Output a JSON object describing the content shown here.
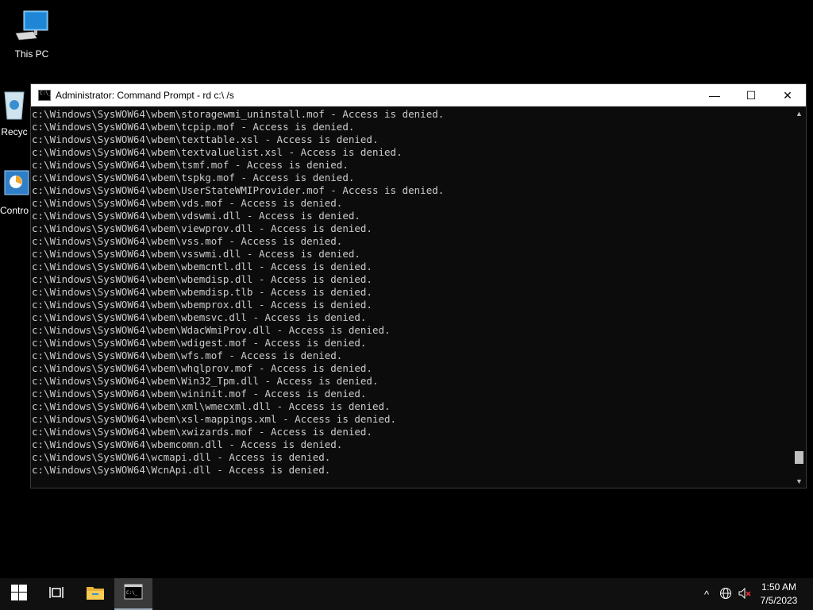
{
  "desktop": {
    "icons": [
      {
        "label": "This PC",
        "icon": "this-pc-icon"
      },
      {
        "label": "Recyc",
        "icon": "recycle-bin-icon"
      },
      {
        "label": "Contro",
        "icon": "control-panel-icon"
      }
    ]
  },
  "window": {
    "title": "Administrator: Command Prompt - rd  c:\\ /s",
    "minimize": "—",
    "maximize": "☐",
    "close": "✕"
  },
  "console_lines": [
    "c:\\Windows\\SysWOW64\\wbem\\storagewmi_uninstall.mof - Access is denied.",
    "c:\\Windows\\SysWOW64\\wbem\\tcpip.mof - Access is denied.",
    "c:\\Windows\\SysWOW64\\wbem\\texttable.xsl - Access is denied.",
    "c:\\Windows\\SysWOW64\\wbem\\textvaluelist.xsl - Access is denied.",
    "c:\\Windows\\SysWOW64\\wbem\\tsmf.mof - Access is denied.",
    "c:\\Windows\\SysWOW64\\wbem\\tspkg.mof - Access is denied.",
    "c:\\Windows\\SysWOW64\\wbem\\UserStateWMIProvider.mof - Access is denied.",
    "c:\\Windows\\SysWOW64\\wbem\\vds.mof - Access is denied.",
    "c:\\Windows\\SysWOW64\\wbem\\vdswmi.dll - Access is denied.",
    "c:\\Windows\\SysWOW64\\wbem\\viewprov.dll - Access is denied.",
    "c:\\Windows\\SysWOW64\\wbem\\vss.mof - Access is denied.",
    "c:\\Windows\\SysWOW64\\wbem\\vsswmi.dll - Access is denied.",
    "c:\\Windows\\SysWOW64\\wbem\\wbemcntl.dll - Access is denied.",
    "c:\\Windows\\SysWOW64\\wbem\\wbemdisp.dll - Access is denied.",
    "c:\\Windows\\SysWOW64\\wbem\\wbemdisp.tlb - Access is denied.",
    "c:\\Windows\\SysWOW64\\wbem\\wbemprox.dll - Access is denied.",
    "c:\\Windows\\SysWOW64\\wbem\\wbemsvc.dll - Access is denied.",
    "c:\\Windows\\SysWOW64\\wbem\\WdacWmiProv.dll - Access is denied.",
    "c:\\Windows\\SysWOW64\\wbem\\wdigest.mof - Access is denied.",
    "c:\\Windows\\SysWOW64\\wbem\\wfs.mof - Access is denied.",
    "c:\\Windows\\SysWOW64\\wbem\\whqlprov.mof - Access is denied.",
    "c:\\Windows\\SysWOW64\\wbem\\Win32_Tpm.dll - Access is denied.",
    "c:\\Windows\\SysWOW64\\wbem\\wininit.mof - Access is denied.",
    "c:\\Windows\\SysWOW64\\wbem\\xml\\wmecxml.dll - Access is denied.",
    "c:\\Windows\\SysWOW64\\wbem\\xsl-mappings.xml - Access is denied.",
    "c:\\Windows\\SysWOW64\\wbem\\xwizards.mof - Access is denied.",
    "c:\\Windows\\SysWOW64\\wbemcomn.dll - Access is denied.",
    "c:\\Windows\\SysWOW64\\wcmapi.dll - Access is denied.",
    "c:\\Windows\\SysWOW64\\WcnApi.dll - Access is denied."
  ],
  "scrollbar": {
    "position_fraction": 0.97
  },
  "taskbar": {
    "start": "start-icon",
    "task_view": "task-view-icon",
    "explorer": "file-explorer-icon",
    "cmd": "command-prompt-icon"
  },
  "tray": {
    "time": "1:50 AM",
    "date": "7/5/2023",
    "chevron": "^"
  },
  "colors": {
    "console_bg": "#0c0c0c",
    "console_text": "#cccccc",
    "taskbar_bg": "#101010"
  }
}
